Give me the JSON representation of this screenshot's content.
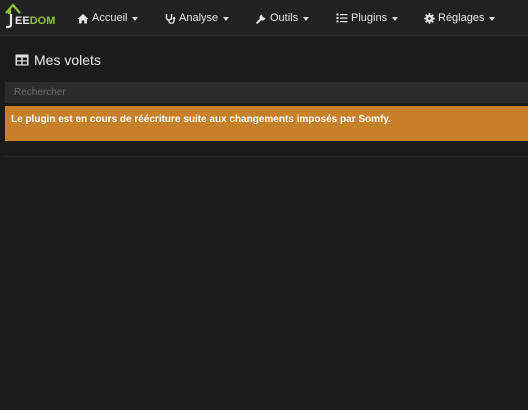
{
  "app": {
    "logo_text_1": "EE",
    "logo_text_2": "DOM",
    "brand_colors": {
      "primary": "#8cc63f",
      "text": "#e6e6e6"
    }
  },
  "nav": {
    "items": [
      {
        "label": "Accueil",
        "icon": "home-icon"
      },
      {
        "label": "Analyse",
        "icon": "stethoscope-icon"
      },
      {
        "label": "Outils",
        "icon": "wrench-icon"
      },
      {
        "label": "Plugins",
        "icon": "list-icon"
      },
      {
        "label": "Réglages",
        "icon": "gear-icon"
      }
    ]
  },
  "page": {
    "title": "Mes volets",
    "title_icon": "table-icon",
    "search_placeholder": "Rechercher",
    "alert_message": "Le plugin est en cours de réécriture suite aux changements imposés par Somfy.",
    "alert_color": "#c6802a"
  }
}
